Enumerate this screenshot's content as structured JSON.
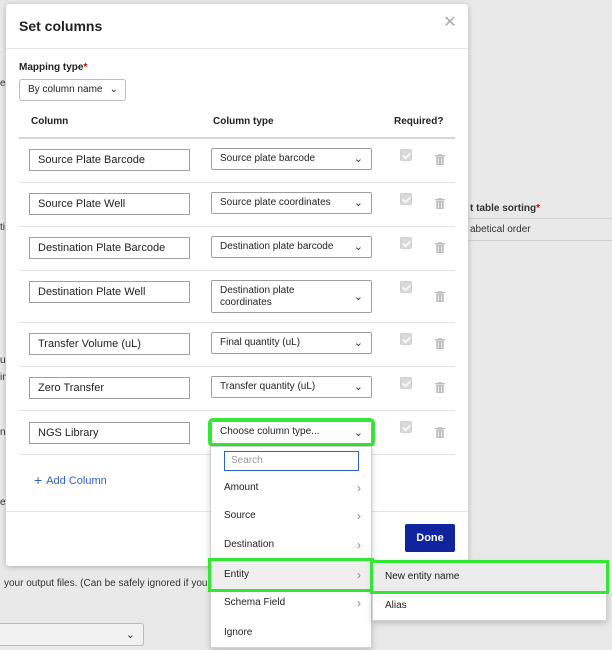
{
  "background": {
    "right_label": "t table sorting",
    "right_required": "*",
    "right_value": "abetical order",
    "bottom_text": "your output files. (Can be safely ignored if your",
    "left_fragments": [
      "er",
      "ti",
      "u",
      "in",
      "n",
      "et"
    ]
  },
  "modal": {
    "title": "Set columns",
    "close_icon": "close-icon",
    "mapping_type_label": "Mapping type",
    "required_marker": "*",
    "mapping_type_value": "By column name",
    "headers": {
      "column": "Column",
      "column_type": "Column type",
      "required": "Required?"
    },
    "rows": [
      {
        "name": "Source Plate Barcode",
        "type": "Source plate barcode",
        "required": true
      },
      {
        "name": "Source Plate Well",
        "type": "Source plate coordinates",
        "required": true
      },
      {
        "name": "Destination Plate Barcode",
        "type": "Destination plate barcode",
        "required": true
      },
      {
        "name": "Destination Plate Well",
        "type": "Destination plate coordinates",
        "required": true
      },
      {
        "name": "Transfer Volume (uL)",
        "type": "Final quantity (uL)",
        "required": true
      },
      {
        "name": "Zero Transfer",
        "type": "Transfer quantity (uL)",
        "required": true
      },
      {
        "name": "NGS Library",
        "type": "Choose column type...",
        "required": true
      }
    ],
    "add_column": "Add Column",
    "done": "Done"
  },
  "dropdown": {
    "search_placeholder": "Search",
    "items": [
      {
        "label": "Amount",
        "has_submenu": true
      },
      {
        "label": "Source",
        "has_submenu": true
      },
      {
        "label": "Destination",
        "has_submenu": true
      },
      {
        "label": "Entity",
        "has_submenu": true
      },
      {
        "label": "Schema Field",
        "has_submenu": true
      },
      {
        "label": "Ignore",
        "has_submenu": false
      }
    ]
  },
  "submenu": {
    "items": [
      "New entity name",
      "Alias"
    ]
  },
  "colors": {
    "highlight": "#33e633",
    "primary_button": "#10249f",
    "link": "#2f62c8",
    "required": "#cc0000"
  }
}
